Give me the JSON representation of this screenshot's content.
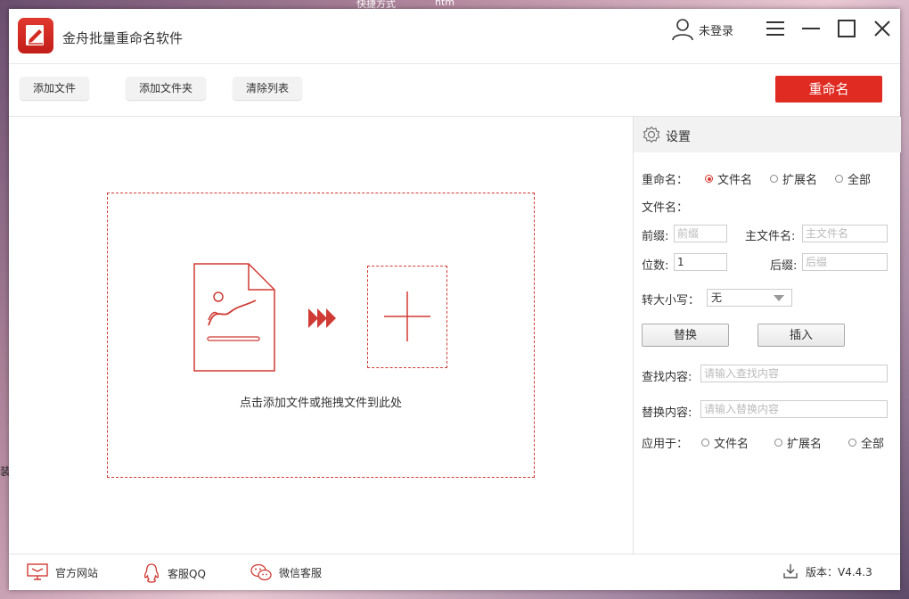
{
  "desktop": {
    "left_text": "快捷方式",
    "right_text": "htm",
    "side_text": "装"
  },
  "app": {
    "title": "金舟批量重命名软件"
  },
  "user": {
    "login_label": "未登录"
  },
  "toolbar": {
    "add_file": "添加文件",
    "add_folder": "添加文件夹",
    "clear_list": "清除列表",
    "rename": "重命名"
  },
  "drop_zone": {
    "hint": "点击添加文件或拖拽文件到此处"
  },
  "settings": {
    "title": "设置",
    "rename_label": "重命名：",
    "rename_options": [
      "文件名",
      "扩展名",
      "全部"
    ],
    "rename_selected": "文件名",
    "filename_label": "文件名：",
    "prefix_label": "前缀:",
    "prefix_placeholder": "前缀",
    "main_name_label": "主文件名:",
    "main_name_placeholder": "主文件名",
    "digits_label": "位数:",
    "digits_value": "1",
    "suffix_label": "后缀:",
    "suffix_placeholder": "后缀",
    "case_label": "转大小写：",
    "case_value": "无",
    "replace_button": "替换",
    "insert_button": "插入",
    "find_label": "查找内容:",
    "find_placeholder": "请输入查找内容",
    "replace_label": "替换内容:",
    "replace_placeholder": "请输入替换内容",
    "apply_label": "应用于：",
    "apply_options": [
      "文件名",
      "扩展名",
      "全部"
    ]
  },
  "footer": {
    "website": "官方网站",
    "qq": "客服QQ",
    "wechat": "微信客服",
    "version": "版本：V4.4.3"
  },
  "colors": {
    "accent": "#e02b22",
    "border_red": "#d03a34"
  }
}
